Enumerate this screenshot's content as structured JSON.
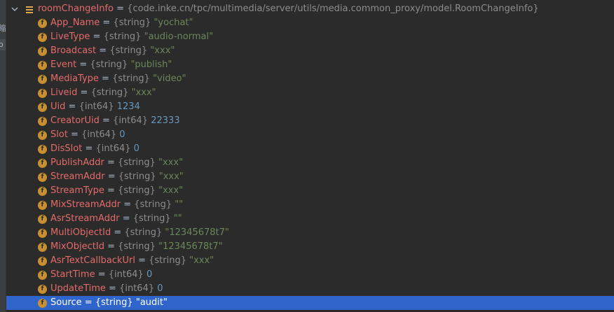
{
  "gutter": {
    "glyph1": "缩",
    "glyph2": "o"
  },
  "root": {
    "name": "roomChangeInfo",
    "eq": " = ",
    "type": "{code.inke.cn/tpc/multimedia/server/utils/media.common_proxy/model.RoomChangeInfo}"
  },
  "fields": [
    {
      "name": "App_Name",
      "type": "{string}",
      "value": "\"yochat\"",
      "kind": "str"
    },
    {
      "name": "LiveType",
      "type": "{string}",
      "value": "\"audio-normal\"",
      "kind": "str"
    },
    {
      "name": "Broadcast",
      "type": "{string}",
      "value": "\"xxx\"",
      "kind": "str"
    },
    {
      "name": "Event",
      "type": "{string}",
      "value": "\"publish\"",
      "kind": "str"
    },
    {
      "name": "MediaType",
      "type": "{string}",
      "value": "\"video\"",
      "kind": "str"
    },
    {
      "name": "Liveid",
      "type": "{string}",
      "value": "\"xxx\"",
      "kind": "str"
    },
    {
      "name": "Uid",
      "type": "{int64}",
      "value": "1234",
      "kind": "num"
    },
    {
      "name": "CreatorUid",
      "type": "{int64}",
      "value": "22333",
      "kind": "num"
    },
    {
      "name": "Slot",
      "type": "{int64}",
      "value": "0",
      "kind": "num"
    },
    {
      "name": "DisSlot",
      "type": "{int64}",
      "value": "0",
      "kind": "num"
    },
    {
      "name": "PublishAddr",
      "type": "{string}",
      "value": "\"xxx\"",
      "kind": "str"
    },
    {
      "name": "StreamAddr",
      "type": "{string}",
      "value": "\"xxx\"",
      "kind": "str"
    },
    {
      "name": "StreamType",
      "type": "{string}",
      "value": "\"xxx\"",
      "kind": "str"
    },
    {
      "name": "MixStreamAddr",
      "type": "{string}",
      "value": "\"\"",
      "kind": "str"
    },
    {
      "name": "AsrStreamAddr",
      "type": "{string}",
      "value": "\"\"",
      "kind": "str"
    },
    {
      "name": "MultiObjectId",
      "type": "{string}",
      "value": "\"12345678t7\"",
      "kind": "str"
    },
    {
      "name": "MixObjectId",
      "type": "{string}",
      "value": "\"12345678t7\"",
      "kind": "str"
    },
    {
      "name": "AsrTextCallbackUrl",
      "type": "{string}",
      "value": "\"xxx\"",
      "kind": "str"
    },
    {
      "name": "StartTime",
      "type": "{int64}",
      "value": "0",
      "kind": "num"
    },
    {
      "name": "UpdateTime",
      "type": "{int64}",
      "value": "0",
      "kind": "num"
    },
    {
      "name": "Source",
      "type": "{string}",
      "value": "\"audit\"",
      "kind": "str",
      "selected": true
    }
  ],
  "field_icon_letter": "f",
  "eq_sign": " = "
}
